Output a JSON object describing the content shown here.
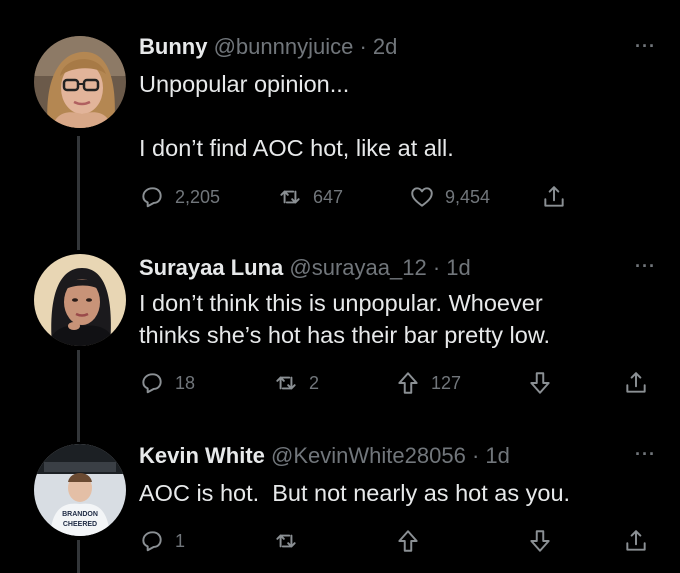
{
  "tweets": [
    {
      "name": "Bunny",
      "handle": "@bunnnyjuice",
      "dot": "·",
      "time": "2d",
      "more": "···",
      "text": "Unpopular opinion...\n\nI don’t find AOC hot, like at all.",
      "replies": "2,205",
      "retweets": "647",
      "likes": "9,454",
      "icons": [
        "reply-icon",
        "retweet-icon",
        "like-icon",
        "share-icon"
      ]
    },
    {
      "name": "Surayaa Luna",
      "handle": "@surayaa_12",
      "dot": "·",
      "time": "1d",
      "more": "···",
      "text": "I don’t think this is unpopular. Whoever\nthinks she’s hot has their bar pretty low.",
      "replies": "18",
      "retweets": "2",
      "upvotes": "127",
      "icons": [
        "reply-icon",
        "retweet-icon",
        "upvote-icon",
        "downvote-icon",
        "share-icon"
      ]
    },
    {
      "name": "Kevin White",
      "handle": "@KevinWhite28056",
      "dot": "·",
      "time": "1d",
      "more": "···",
      "text": "AOC is hot.  But not nearly as hot as you.",
      "replies": "1",
      "avatar_text": [
        "BRANDON",
        "CHEERED"
      ],
      "icons": [
        "reply-icon",
        "retweet-icon",
        "upvote-icon",
        "downvote-icon",
        "share-icon"
      ]
    }
  ],
  "colors": {
    "background": "#000000",
    "text": "#e7e9ea",
    "muted": "#71767b"
  }
}
